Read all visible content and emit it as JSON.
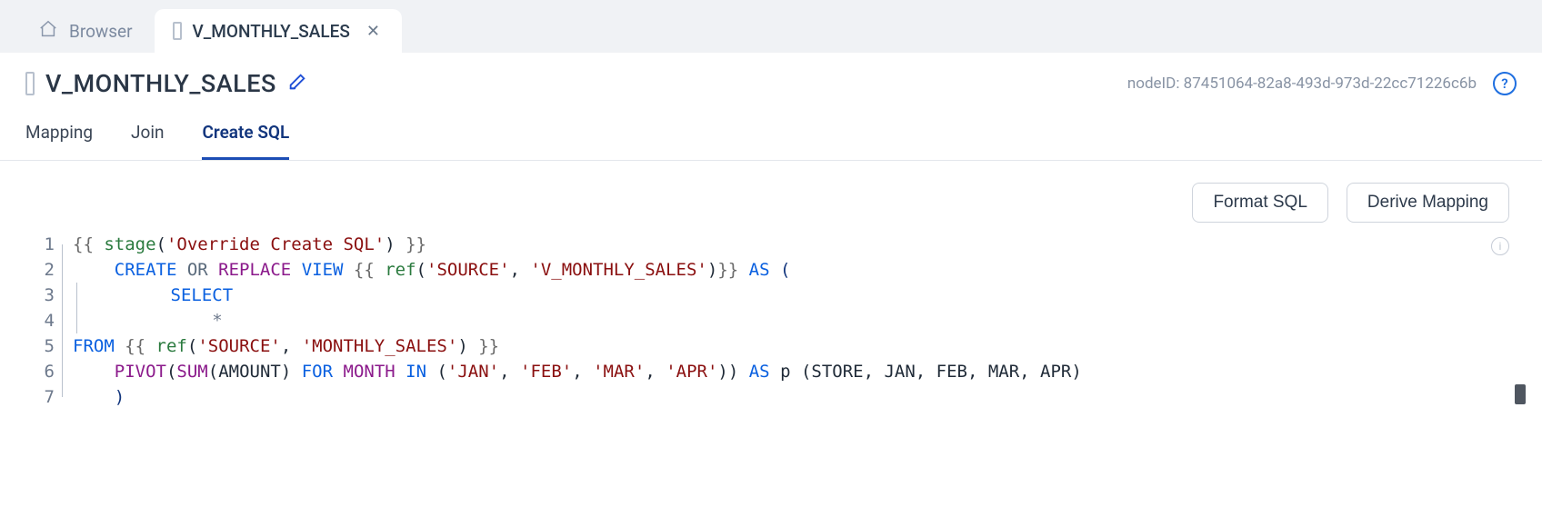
{
  "tabs": {
    "browser_label": "Browser",
    "active_label": "V_MONTHLY_SALES"
  },
  "page": {
    "title": "V_MONTHLY_SALES",
    "node_id_label": "nodeID: 87451064-82a8-493d-973d-22cc71226c6b"
  },
  "subtabs": {
    "mapping": "Mapping",
    "join": "Join",
    "create_sql": "Create SQL"
  },
  "toolbar": {
    "format_sql": "Format SQL",
    "derive_mapping": "Derive Mapping"
  },
  "editor": {
    "lines": [
      "1",
      "2",
      "3",
      "4",
      "5",
      "6",
      "7"
    ],
    "l1": {
      "dl": "{{ ",
      "fn": "stage",
      "p1": "(",
      "arg": "'Override Create SQL'",
      "p2": ")",
      "dr": " }}"
    },
    "l2": {
      "indent": "    ",
      "create": "CREATE ",
      "or": "OR ",
      "replace": "REPLACE ",
      "view": "VIEW ",
      "dl": "{{ ",
      "ref": "ref",
      "p1": "(",
      "a1": "'SOURCE'",
      "comma": ", ",
      "a2": "'V_MONTHLY_SALES'",
      "p2": ")",
      "dr": "}} ",
      "as": "AS ",
      "open": "("
    },
    "l3": {
      "indent": "        ",
      "select": "SELECT"
    },
    "l4": {
      "indent": "            ",
      "star": "*"
    },
    "l5": {
      "from": "FROM ",
      "dl": "{{ ",
      "ref": "ref",
      "p1": "(",
      "a1": "'SOURCE'",
      "comma": ", ",
      "a2": "'MONTHLY_SALES'",
      "p2": ")",
      "dr": " }}"
    },
    "l6": {
      "indent": "    ",
      "pivot": "PIVOT",
      "p1": "(",
      "sum": "SUM",
      "p2": "(",
      "amount": "AMOUNT",
      "p3": ") ",
      "for": "FOR ",
      "month": "MONTH ",
      "in": "IN ",
      "p4": "(",
      "m1": "'JAN'",
      "c": ", ",
      "m2": "'FEB'",
      "m3": "'MAR'",
      "m4": "'APR'",
      "p5": ")) ",
      "as": "AS ",
      "rest": "p (STORE, JAN, FEB, MAR, APR)"
    },
    "l7": {
      "indent": "    ",
      "close": ")"
    }
  }
}
